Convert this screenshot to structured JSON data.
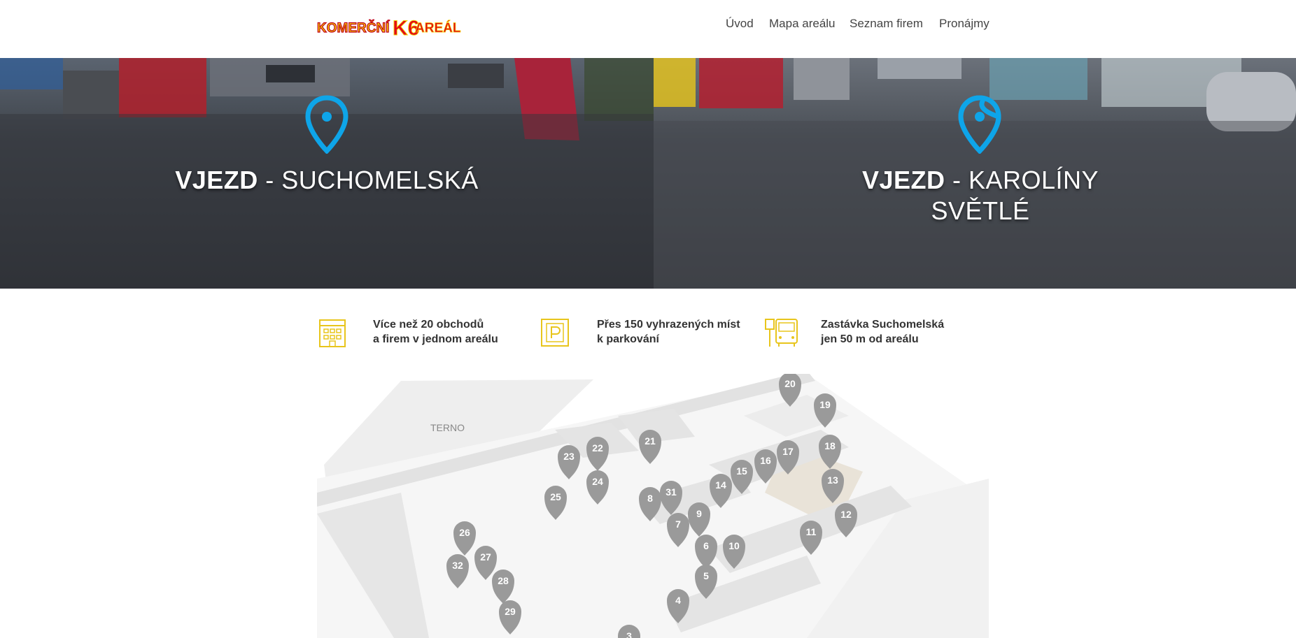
{
  "brand": {
    "logo_text_left": "KOMERČNÍ",
    "logo_number": "K6",
    "logo_text_right": "AREÁL"
  },
  "nav": {
    "items": [
      {
        "label": "Úvod"
      },
      {
        "label": "Mapa areálu"
      },
      {
        "label": "Seznam firem"
      },
      {
        "label": "Pronájmy"
      }
    ]
  },
  "slider": {
    "slides": [
      {
        "bold": "VJEZD",
        "dash": " - ",
        "rest": "SUCHOMELSKÁ",
        "rest2": ""
      },
      {
        "bold": "VJEZD",
        "dash": " - ",
        "rest": "KAROLÍNY",
        "rest2": "SVĚTLÉ"
      }
    ],
    "active_dot": 1,
    "dot_count": 2
  },
  "features": [
    {
      "icon": "building-icon",
      "line1": "Více než 20 obchodů",
      "line2": "a firem v jednom areálu"
    },
    {
      "icon": "parking-icon",
      "line1": "Přes 150 vyhrazených míst",
      "line2": "k parkování"
    },
    {
      "icon": "bus-stop-icon",
      "line1": "Zastávka Suchomelská",
      "line2": "jen 50 m od areálu"
    }
  ],
  "map": {
    "area_label": "TERNO",
    "pins": [
      "20",
      "19",
      "21",
      "22",
      "23",
      "18",
      "17",
      "16",
      "15",
      "24",
      "14",
      "13",
      "31",
      "8",
      "25",
      "9",
      "12",
      "7",
      "26",
      "11",
      "6",
      "10",
      "27",
      "32",
      "28",
      "5",
      "4",
      "29",
      "3"
    ]
  },
  "colors": {
    "accent_blue": "#0ea5e9",
    "brand_yellow": "#e8c51c",
    "pin_gray": "#9a9a9a"
  }
}
